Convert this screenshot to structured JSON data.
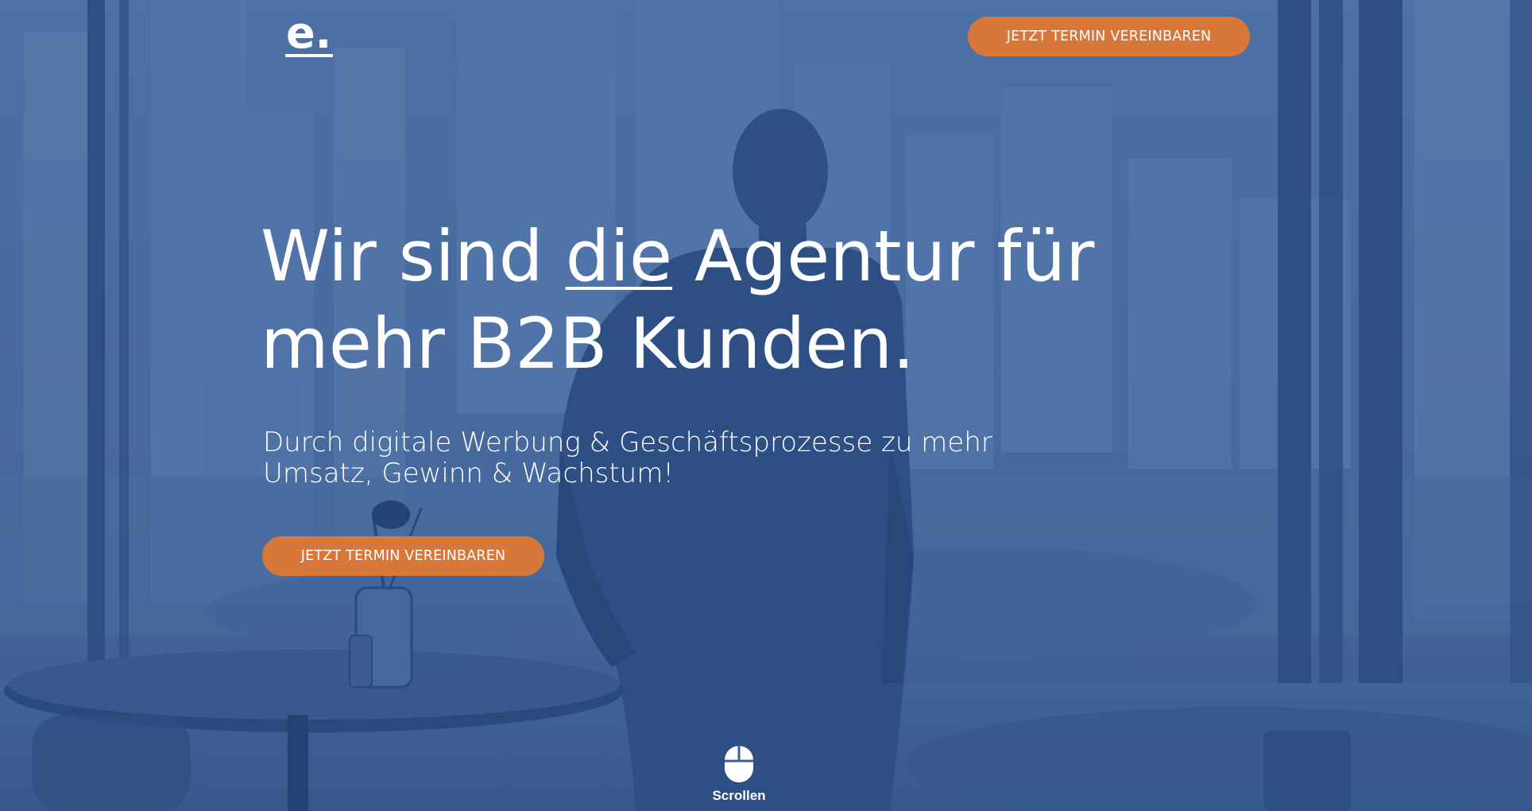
{
  "colors": {
    "overlay": "#3d5f93",
    "accent": "#d7773a",
    "text": "#ffffff"
  },
  "header": {
    "logo_text": "e.",
    "cta_label": "JETZT TERMIN VEREINBAREN"
  },
  "hero": {
    "headline_part1": "Wir sind ",
    "headline_underlined": "die",
    "headline_part2": " Agentur für",
    "headline_line2": "mehr B2B Kunden.",
    "subline_line1": "Durch digitale Werbung & Geschäftsprozesse zu mehr",
    "subline_line2": "Umsatz, Gewinn & Wachstum!",
    "cta_label": "JETZT TERMIN VEREINBAREN"
  },
  "scroll": {
    "icon": "mouse-icon",
    "label": "Scrollen"
  }
}
